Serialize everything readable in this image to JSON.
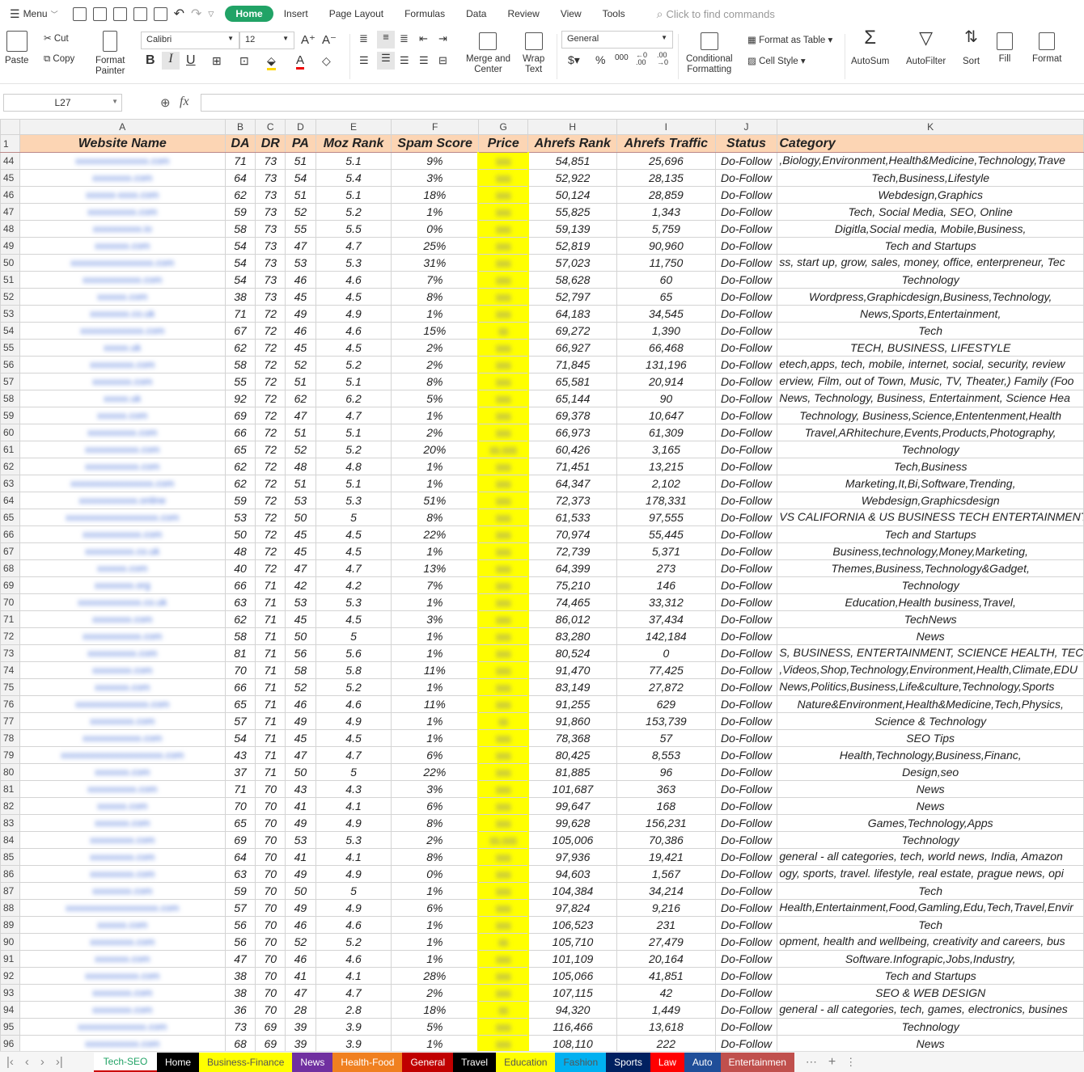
{
  "menubar": {
    "menu_label": "Menu",
    "tabs": [
      "Home",
      "Insert",
      "Page Layout",
      "Formulas",
      "Data",
      "Review",
      "View",
      "Tools"
    ],
    "search_placeholder": "Click to find commands"
  },
  "ribbon": {
    "paste": "Paste",
    "cut": "Cut",
    "copy": "Copy",
    "format_painter": [
      "Format",
      "Painter"
    ],
    "font_name": "Calibri",
    "font_size": "12",
    "merge_center": [
      "Merge and",
      "Center"
    ],
    "wrap_text": [
      "Wrap",
      "Text"
    ],
    "number_format": "General",
    "conditional_formatting": [
      "Conditional",
      "Formatting"
    ],
    "format_as_table": "Format as Table",
    "cell_style": "Cell Style",
    "autosum": "AutoSum",
    "autofilter": "AutoFilter",
    "sort": "Sort",
    "fill": "Fill",
    "format": "Format"
  },
  "formula_bar": {
    "name_box": "L27",
    "fx": "fx",
    "value": ""
  },
  "columns": [
    "",
    "A",
    "B",
    "C",
    "D",
    "E",
    "F",
    "G",
    "H",
    "I",
    "J",
    "K"
  ],
  "header_row": {
    "row": "1",
    "cells": [
      "Website Name",
      "DA",
      "DR",
      "PA",
      "Moz Rank",
      "Spam Score",
      "Price",
      "Ahrefs Rank",
      "Ahrefs Traffic",
      "Status",
      "Category"
    ]
  },
  "rows": [
    [
      "44",
      "xxxxxxxxxxxxxxx.com",
      "71",
      "73",
      "51",
      "5.1",
      "9%",
      "$$$",
      "54,851",
      "25,696",
      "Do-Follow",
      ",Biology,Environment,Health&Medicine,Technology,Trave"
    ],
    [
      "45",
      "xxxxxxxx.com",
      "64",
      "73",
      "54",
      "5.4",
      "3%",
      "$$$",
      "52,922",
      "28,135",
      "Do-Follow",
      "Tech,Business,Lifestyle"
    ],
    [
      "46",
      "xxxxxx-xxxx.com",
      "62",
      "73",
      "51",
      "5.1",
      "18%",
      "$$$",
      "50,124",
      "28,859",
      "Do-Follow",
      "Webdesign,Graphics"
    ],
    [
      "47",
      "xxxxxxxxxx.com",
      "59",
      "73",
      "52",
      "5.2",
      "1%",
      "$$$",
      "55,825",
      "1,343",
      "Do-Follow",
      "Tech, Social Media, SEO, Online"
    ],
    [
      "48",
      "xxxxxxxxxx.io",
      "58",
      "73",
      "55",
      "5.5",
      "0%",
      "$$$",
      "59,139",
      "5,759",
      "Do-Follow",
      "Digitla,Social media, Mobile,Business,"
    ],
    [
      "49",
      "xxxxxxx.com",
      "54",
      "73",
      "47",
      "4.7",
      "25%",
      "$$$",
      "52,819",
      "90,960",
      "Do-Follow",
      "Tech and Startups"
    ],
    [
      "50",
      "xxxxxxxxxxxxxxxxx.com",
      "54",
      "73",
      "53",
      "5.3",
      "31%",
      "$$$",
      "57,023",
      "11,750",
      "Do-Follow",
      "ss, start up, grow, sales, money, office, enterpreneur, Tec"
    ],
    [
      "51",
      "xxxxxxxxxxxx.com",
      "54",
      "73",
      "46",
      "4.6",
      "7%",
      "$$$",
      "58,628",
      "60",
      "Do-Follow",
      "Technology"
    ],
    [
      "52",
      "xxxxxx.com",
      "38",
      "73",
      "45",
      "4.5",
      "8%",
      "$$$",
      "52,797",
      "65",
      "Do-Follow",
      "Wordpress,Graphicdesign,Business,Technology,"
    ],
    [
      "53",
      "xxxxxxxx.co.uk",
      "71",
      "72",
      "49",
      "4.9",
      "1%",
      "$$$",
      "64,183",
      "34,545",
      "Do-Follow",
      "News,Sports,Entertainment,"
    ],
    [
      "54",
      "xxxxxxxxxxxxx.com",
      "67",
      "72",
      "46",
      "4.6",
      "15%",
      "$$",
      "69,272",
      "1,390",
      "Do-Follow",
      "Tech"
    ],
    [
      "55",
      "xxxxx.uk",
      "62",
      "72",
      "45",
      "4.5",
      "2%",
      "$$$",
      "66,927",
      "66,468",
      "Do-Follow",
      "TECH, BUSINESS, LIFESTYLE"
    ],
    [
      "56",
      "xxxxxxxxx.com",
      "58",
      "72",
      "52",
      "5.2",
      "2%",
      "$$$",
      "71,845",
      "131,196",
      "Do-Follow",
      "etech,apps, tech, mobile, internet, social, security, review"
    ],
    [
      "57",
      "xxxxxxxx.com",
      "55",
      "72",
      "51",
      "5.1",
      "8%",
      "$$$",
      "65,581",
      "20,914",
      "Do-Follow",
      "erview, Film, out of Town, Music, TV, Theater,) Family (Foo"
    ],
    [
      "58",
      "xxxxx.uk",
      "92",
      "72",
      "62",
      "6.2",
      "5%",
      "$$$",
      "65,144",
      "90",
      "Do-Follow",
      "News, Technology, Business, Entertainment, Science  Hea"
    ],
    [
      "59",
      "xxxxxx.com",
      "69",
      "72",
      "47",
      "4.7",
      "1%",
      "$$$",
      "69,378",
      "10,647",
      "Do-Follow",
      "Technology, Business,Science,Ententenment,Health"
    ],
    [
      "60",
      "xxxxxxxxxx.com",
      "66",
      "72",
      "51",
      "5.1",
      "2%",
      "$$$",
      "66,973",
      "61,309",
      "Do-Follow",
      "Travel,ARhitechure,Events,Products,Photography,"
    ],
    [
      "61",
      "xxxxxxxxxxx.com",
      "65",
      "72",
      "52",
      "5.2",
      "20%",
      "$$,$$$",
      "60,426",
      "3,165",
      "Do-Follow",
      "Technology"
    ],
    [
      "62",
      "xxxxxxxxxxx.com",
      "62",
      "72",
      "48",
      "4.8",
      "1%",
      "$$$",
      "71,451",
      "13,215",
      "Do-Follow",
      "Tech,Business"
    ],
    [
      "63",
      "xxxxxxxxxxxxxxxxx.com",
      "62",
      "72",
      "51",
      "5.1",
      "1%",
      "$$$",
      "64,347",
      "2,102",
      "Do-Follow",
      "Marketing,It,Bi,Software,Trending,"
    ],
    [
      "64",
      "xxxxxxxxxxxx.online",
      "59",
      "72",
      "53",
      "5.3",
      "51%",
      "$$$",
      "72,373",
      "178,331",
      "Do-Follow",
      "Webdesign,Graphicsdesign"
    ],
    [
      "65",
      "xxxxxxxxxxxxxxxxxxx.com",
      "53",
      "72",
      "50",
      "5",
      "8%",
      "$$$",
      "61,533",
      "97,555",
      "Do-Follow",
      "VS CALIFORNIA & US BUSINESS TECH ENTERTAINMENT HE"
    ],
    [
      "66",
      "xxxxxxxxxxxx.com",
      "50",
      "72",
      "45",
      "4.5",
      "22%",
      "$$$",
      "70,974",
      "55,445",
      "Do-Follow",
      "Tech and Startups"
    ],
    [
      "67",
      "xxxxxxxxxx.co.uk",
      "48",
      "72",
      "45",
      "4.5",
      "1%",
      "$$$",
      "72,739",
      "5,371",
      "Do-Follow",
      "Business,technology,Money,Marketing,"
    ],
    [
      "68",
      "xxxxxx.com",
      "40",
      "72",
      "47",
      "4.7",
      "13%",
      "$$$",
      "64,399",
      "273",
      "Do-Follow",
      "Themes,Business,Technology&Gadget,"
    ],
    [
      "69",
      "xxxxxxxx.org",
      "66",
      "71",
      "42",
      "4.2",
      "7%",
      "$$$",
      "75,210",
      "146",
      "Do-Follow",
      "Technology"
    ],
    [
      "70",
      "xxxxxxxxxxxxx.co.uk",
      "63",
      "71",
      "53",
      "5.3",
      "1%",
      "$$$",
      "74,465",
      "33,312",
      "Do-Follow",
      "Education,Health business,Travel,"
    ],
    [
      "71",
      "xxxxxxxx.com",
      "62",
      "71",
      "45",
      "4.5",
      "3%",
      "$$$",
      "86,012",
      "37,434",
      "Do-Follow",
      "TechNews"
    ],
    [
      "72",
      "xxxxxxxxxxxx.com",
      "58",
      "71",
      "50",
      "5",
      "1%",
      "$$$",
      "83,280",
      "142,184",
      "Do-Follow",
      "News"
    ],
    [
      "73",
      "xxxxxxxxxx.com",
      "81",
      "71",
      "56",
      "5.6",
      "1%",
      "$$$",
      "80,524",
      "0",
      "Do-Follow",
      "S, BUSINESS, ENTERTAINMENT, SCIENCE  HEALTH, TECHN"
    ],
    [
      "74",
      "xxxxxxxx.com",
      "70",
      "71",
      "58",
      "5.8",
      "11%",
      "$$$",
      "91,470",
      "77,425",
      "Do-Follow",
      ",Videos,Shop,Technology,Environment,Health,Climate,EDU"
    ],
    [
      "75",
      "xxxxxxx.com",
      "66",
      "71",
      "52",
      "5.2",
      "1%",
      "$$$",
      "83,149",
      "27,872",
      "Do-Follow",
      "News,Politics,Business,Life&culture,Technology,Sports"
    ],
    [
      "76",
      "xxxxxxxxxxxxxxx.com",
      "65",
      "71",
      "46",
      "4.6",
      "11%",
      "$$$",
      "91,255",
      "629",
      "Do-Follow",
      "Nature&Environment,Health&Medicine,Tech,Physics,"
    ],
    [
      "77",
      "xxxxxxxxx.com",
      "57",
      "71",
      "49",
      "4.9",
      "1%",
      "$$",
      "91,860",
      "153,739",
      "Do-Follow",
      "Science & Technology"
    ],
    [
      "78",
      "xxxxxxxxxxxx.com",
      "54",
      "71",
      "45",
      "4.5",
      "1%",
      "$$$",
      "78,368",
      "57",
      "Do-Follow",
      "SEO Tips"
    ],
    [
      "79",
      "xxxxxxxxxxxxxxxxxxxxx.com",
      "43",
      "71",
      "47",
      "4.7",
      "6%",
      "$$$",
      "80,425",
      "8,553",
      "Do-Follow",
      "Health,Technology,Business,Financ,"
    ],
    [
      "80",
      "xxxxxxx.com",
      "37",
      "71",
      "50",
      "5",
      "22%",
      "$$$",
      "81,885",
      "96",
      "Do-Follow",
      "Design,seo"
    ],
    [
      "81",
      "xxxxxxxxxx.com",
      "71",
      "70",
      "43",
      "4.3",
      "3%",
      "$$$",
      "101,687",
      "363",
      "Do-Follow",
      "News"
    ],
    [
      "82",
      "xxxxxx.com",
      "70",
      "70",
      "41",
      "4.1",
      "6%",
      "$$$",
      "99,647",
      "168",
      "Do-Follow",
      "News"
    ],
    [
      "83",
      "xxxxxxx.com",
      "65",
      "70",
      "49",
      "4.9",
      "8%",
      "$$$",
      "99,628",
      "156,231",
      "Do-Follow",
      "Games,Technology,Apps"
    ],
    [
      "84",
      "xxxxxxxxx.com",
      "69",
      "70",
      "53",
      "5.3",
      "2%",
      "$$,$$$",
      "105,006",
      "70,386",
      "Do-Follow",
      "Technology"
    ],
    [
      "85",
      "xxxxxxxxx.com",
      "64",
      "70",
      "41",
      "4.1",
      "8%",
      "$$$",
      "97,936",
      "19,421",
      "Do-Follow",
      " general - all categories, tech, world news, India, Amazon"
    ],
    [
      "86",
      "xxxxxxxxx.com",
      "63",
      "70",
      "49",
      "4.9",
      "0%",
      "$$$",
      "94,603",
      "1,567",
      "Do-Follow",
      "ogy, sports, travel. lifestyle, real estate, prague news, opi"
    ],
    [
      "87",
      "xxxxxxxx.com",
      "59",
      "70",
      "50",
      "5",
      "1%",
      "$$$",
      "104,384",
      "34,214",
      "Do-Follow",
      "Tech"
    ],
    [
      "88",
      "xxxxxxxxxxxxxxxxxxx.com",
      "57",
      "70",
      "49",
      "4.9",
      "6%",
      "$$$",
      "97,824",
      "9,216",
      "Do-Follow",
      "Health,Entertainment,Food,Gamling,Edu,Tech,Travel,Envir"
    ],
    [
      "89",
      "xxxxxx.com",
      "56",
      "70",
      "46",
      "4.6",
      "1%",
      "$$$",
      "106,523",
      "231",
      "Do-Follow",
      "Tech"
    ],
    [
      "90",
      "xxxxxxxxx.com",
      "56",
      "70",
      "52",
      "5.2",
      "1%",
      "$$",
      "105,710",
      "27,479",
      "Do-Follow",
      "opment, health and wellbeing, creativity and careers, bus"
    ],
    [
      "91",
      "xxxxxxx.com",
      "47",
      "70",
      "46",
      "4.6",
      "1%",
      "$$$",
      "101,109",
      "20,164",
      "Do-Follow",
      "Software.Infograpic,Jobs,Industry,"
    ],
    [
      "92",
      "xxxxxxxxxxx.com",
      "38",
      "70",
      "41",
      "4.1",
      "28%",
      "$$$",
      "105,066",
      "41,851",
      "Do-Follow",
      "Tech and Startups"
    ],
    [
      "93",
      "xxxxxxxx.com",
      "38",
      "70",
      "47",
      "4.7",
      "2%",
      "$$$",
      "107,115",
      "42",
      "Do-Follow",
      "SEO & WEB DESIGN"
    ],
    [
      "94",
      "xxxxxxxx.com",
      "36",
      "70",
      "28",
      "2.8",
      "18%",
      "$$",
      "94,320",
      "1,449",
      "Do-Follow",
      "general - all categories, tech, games, electronics, busines"
    ],
    [
      "95",
      "xxxxxxxxxxxxxx.com",
      "73",
      "69",
      "39",
      "3.9",
      "5%",
      "$$$",
      "116,466",
      "13,618",
      "Do-Follow",
      "Technology"
    ],
    [
      "96",
      "xxxxxxxxxxx.com",
      "68",
      "69",
      "39",
      "3.9",
      "1%",
      "$$$",
      "108,110",
      "222",
      "Do-Follow",
      "News"
    ]
  ],
  "sheet_tabs": [
    {
      "label": "Tech-SEO",
      "color": "#ffffff",
      "text": "#21a366"
    },
    {
      "label": "Home",
      "color": "#000000",
      "text": "#ffffff"
    },
    {
      "label": "Business-Finance",
      "color": "#ffff00",
      "text": "#555555"
    },
    {
      "label": "News",
      "color": "#7030a0",
      "text": "#ffffff"
    },
    {
      "label": "Health-Food",
      "color": "#f08020",
      "text": "#ffffff"
    },
    {
      "label": "General",
      "color": "#c00000",
      "text": "#ffffff"
    },
    {
      "label": "Travel",
      "color": "#000000",
      "text": "#ffffff"
    },
    {
      "label": "Education",
      "color": "#ffff00",
      "text": "#555555"
    },
    {
      "label": "Fashion",
      "color": "#00b0f0",
      "text": "#555555"
    },
    {
      "label": "Sports",
      "color": "#002060",
      "text": "#ffffff"
    },
    {
      "label": "Law",
      "color": "#ff0000",
      "text": "#ffffff"
    },
    {
      "label": "Auto",
      "color": "#1f4e99",
      "text": "#ffffff"
    },
    {
      "label": "Entertainmen",
      "color": "#c0504d",
      "text": "#ffffff"
    }
  ],
  "colors": {
    "accent": "#21a366",
    "header_fill": "#fcd5b4",
    "price_fill": "#ffff00",
    "link_blur": "#4a73d9"
  }
}
